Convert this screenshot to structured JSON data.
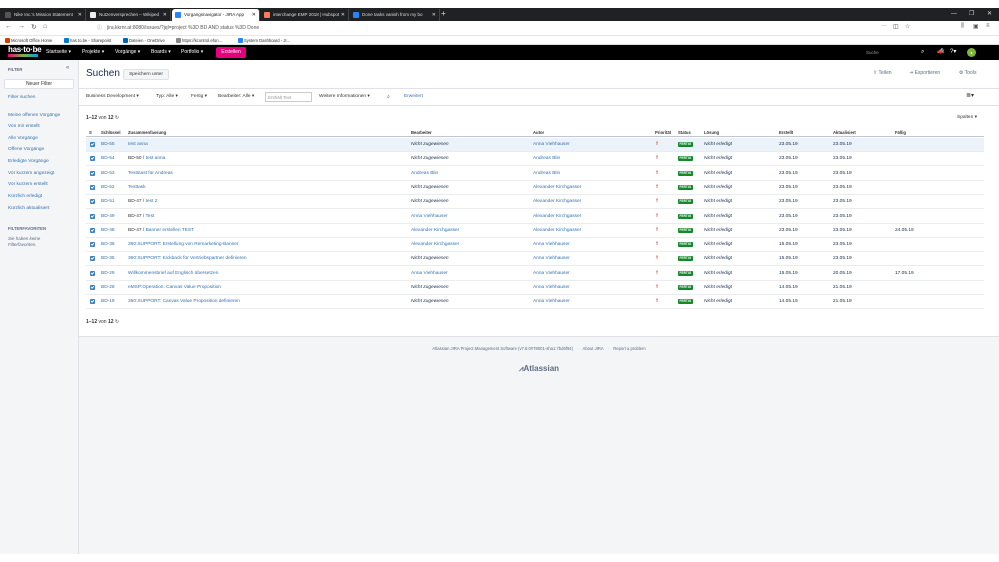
{
  "browser": {
    "tabs": [
      {
        "title": "Nike Inc.'s Mission Statement"
      },
      {
        "title": "Nutzenversprechen – Wikiped"
      },
      {
        "title": "Vorgangsnavigator - JIRA App"
      },
      {
        "title": "interchange EMP 2018 | Hubspot"
      },
      {
        "title": "Done tasks vanish from my bo"
      }
    ],
    "url": "jira.kkrnr.at:8080/issues/?jql=project %3D BD AND status %3D Done",
    "bookmarks": [
      {
        "label": "Microsoft Office Home"
      },
      {
        "label": "has.to.be - Sharepoint"
      },
      {
        "label": "Dateien - OneDrive"
      },
      {
        "label": "https://kcontrol.efon..."
      },
      {
        "label": "System Dashboard - JI..."
      }
    ]
  },
  "header": {
    "logo": "has·to·be",
    "menu": [
      "Startseite ▾",
      "Projekte ▾",
      "Vorgänge ▾",
      "Boards ▾",
      "Portfolio ▾"
    ],
    "create_label": "Erstellen",
    "search_placeholder": "Suche"
  },
  "sidebar": {
    "title": "FILTER",
    "new_filter": "Neuer Filter",
    "search_filters": "Filter suchen",
    "links": [
      "Meine offenen Vorgänge",
      "Von mir erstellt",
      "Alle Vorgänge",
      "Offene Vorgänge",
      "Erledigte Vorgänge",
      "Vor kurzem angezeigt",
      "Vor kurzem erstellt",
      "Kürzlich erledigt",
      "Kürzlich aktualisiert"
    ],
    "favorites_title": "FILTERFAVORITEN",
    "favorites_text": "Sie haben keine Filterfavoriten."
  },
  "main": {
    "title": "Suchen",
    "save_as": "Speichern unter",
    "share": "Teilen",
    "export": "Exportieren",
    "tools": "Tools",
    "criteria": {
      "project": "Business Development ▾",
      "type": "Typ: Alle ▾",
      "status": "Fertig ▾",
      "assignee": "Bearbeiter: Alle ▾",
      "text_placeholder": "Enthält Text",
      "more": "Weitere Informationen ▾",
      "advanced": "Erweitert"
    },
    "count_prefix": "1–12",
    "count_middle": "von",
    "count_total": "12",
    "columns_label": "Spalten ▾",
    "headers": {
      "t": "S",
      "key": "Schlüssel",
      "summary": "Zusammenfassung",
      "assignee": "Bearbeiter",
      "reporter": "Autor",
      "priority": "Priorität",
      "status": "Status",
      "resolution": "Lösung",
      "created": "Erstellt",
      "updated": "Aktualisiert",
      "due": "Fällig"
    },
    "rows": [
      {
        "key": "BD-55",
        "parent": "",
        "summary": "test anna",
        "assignee": "Nicht zugewiesen",
        "reporter": "Anna Viehhauser",
        "status": "FERTIG",
        "resolution": "Nicht erledigt",
        "created": "23.05.19",
        "updated": "23.05.19",
        "due": ""
      },
      {
        "key": "BD-54",
        "parent": "BD-50 /",
        "summary": "test anna",
        "assignee": "Nicht zugewiesen",
        "reporter": "Andreas Blin",
        "status": "FERTIG",
        "resolution": "Nicht erledigt",
        "created": "23.05.19",
        "updated": "23.05.19",
        "due": ""
      },
      {
        "key": "BD-53",
        "parent": "",
        "summary": "Teststast für Andreas",
        "assignee": "Andreas Blin",
        "reporter": "Andreas Blin",
        "status": "FERTIG",
        "resolution": "Nicht erledigt",
        "created": "23.05.19",
        "updated": "23.05.19",
        "due": ""
      },
      {
        "key": "BD-52",
        "parent": "",
        "summary": "Testtask",
        "assignee": "Nicht zugewiesen",
        "reporter": "Alexander Kirchgasser",
        "status": "FERTIG",
        "resolution": "Nicht erledigt",
        "created": "23.05.19",
        "updated": "23.05.19",
        "due": ""
      },
      {
        "key": "BD-51",
        "parent": "BD-47 /",
        "summary": "test 2",
        "assignee": "Nicht zugewiesen",
        "reporter": "Alexander Kirchgasser",
        "status": "FERTIG",
        "resolution": "Nicht erledigt",
        "created": "23.05.19",
        "updated": "23.05.19",
        "due": ""
      },
      {
        "key": "BD-49",
        "parent": "BD-47 /",
        "summary": "Test",
        "assignee": "Anna Viehhauser",
        "reporter": "Alexander Kirchgasser",
        "status": "FERTIG",
        "resolution": "Nicht erledigt",
        "created": "23.05.19",
        "updated": "23.05.19",
        "due": ""
      },
      {
        "key": "BD-48",
        "parent": "BD-47 /",
        "summary": "Banner erstellen TEST",
        "assignee": "Alexander Kirchgasser",
        "reporter": "Alexander Kirchgasser",
        "status": "FERTIG",
        "resolution": "Nicht erledigt",
        "created": "23.05.19",
        "updated": "23.05.19",
        "due": "24.05.19"
      },
      {
        "key": "BD-36",
        "parent": "",
        "summary": "360:SUPPORT: Erstellung von Remarketing-Banner",
        "assignee": "Alexander Kirchgasser",
        "reporter": "Anna Viehhauser",
        "status": "FERTIG",
        "resolution": "Nicht erledigt",
        "created": "15.05.19",
        "updated": "23.05.19",
        "due": ""
      },
      {
        "key": "BD-35",
        "parent": "",
        "summary": "360:SUPPORT: Kickback für Vertriebspartner definieren",
        "assignee": "Nicht zugewiesen",
        "reporter": "Anna Viehhauser",
        "status": "FERTIG",
        "resolution": "Nicht erledigt",
        "created": "15.05.19",
        "updated": "23.05.19",
        "due": ""
      },
      {
        "key": "BD-29",
        "parent": "",
        "summary": "Willkommensbrief auf Englisch übersetzen",
        "assignee": "Anna Viehhauser",
        "reporter": "Anna Viehhauser",
        "status": "FERTIG",
        "resolution": "Nicht erledigt",
        "created": "15.05.19",
        "updated": "20.05.19",
        "due": "17.05.19"
      },
      {
        "key": "BD-28",
        "parent": "",
        "summary": "eMSP:Operation: Canvas Value Proposition",
        "assignee": "Nicht zugewiesen",
        "reporter": "Anna Viehhauser",
        "status": "FERTIG",
        "resolution": "Nicht erledigt",
        "created": "14.05.19",
        "updated": "21.05.19",
        "due": ""
      },
      {
        "key": "BD-19",
        "parent": "",
        "summary": "360:SUPPORT: Canvas Value Proposition definieren",
        "assignee": "Nicht zugewiesen",
        "reporter": "Anna Viehhauser",
        "status": "FERTIG",
        "resolution": "Nicht erledigt",
        "created": "14.05.19",
        "updated": "21.05.19",
        "due": ""
      }
    ]
  },
  "footer": {
    "version": "Atlassian JIRA Project Management Software (v7.8.0#78001-sha1:7bd6f94)",
    "about": "About JIRA",
    "report": "Report a problem",
    "logo": "Atlassian"
  },
  "colors": {
    "accent": "#e6007e",
    "link": "#3572b0",
    "status_done": "#14892c",
    "header_bg": "#000000"
  }
}
